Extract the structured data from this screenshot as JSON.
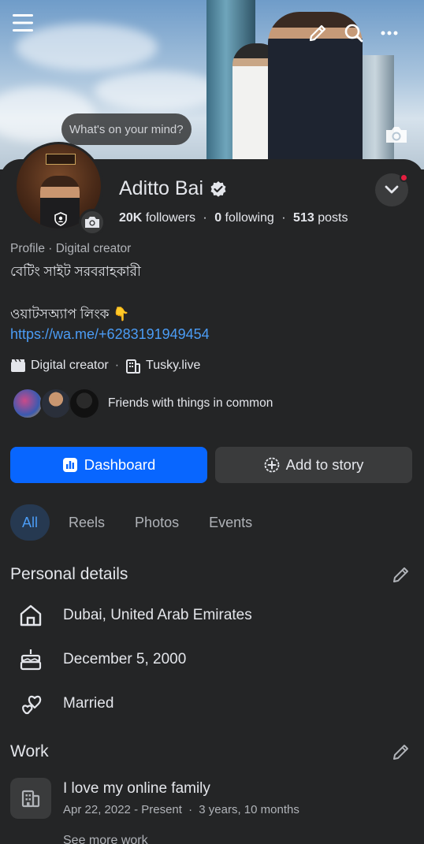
{
  "cover": {
    "status_bubble": "What's on your mind?"
  },
  "profile": {
    "name": "Aditto Bai",
    "followers_count": "20K",
    "followers_label": "followers",
    "following_count": "0",
    "following_label": "following",
    "posts_count": "513",
    "posts_label": "posts",
    "meta_line": "Profile · Digital creator",
    "bio_line1": "বেটিং সাইট সরবরাহকারী",
    "bio_line2": "ওয়াটসঅ্যাপ লিংক 👇",
    "link": "https://wa.me/+6283191949454",
    "tag_category": "Digital creator",
    "tag_separator": "·",
    "tag_site": "Tusky.live",
    "friends_label": "Friends with things in common"
  },
  "buttons": {
    "dashboard": "Dashboard",
    "add_story": "Add to story"
  },
  "tabs": [
    {
      "label": "All",
      "active": true
    },
    {
      "label": "Reels",
      "active": false
    },
    {
      "label": "Photos",
      "active": false
    },
    {
      "label": "Events",
      "active": false
    }
  ],
  "personal_details": {
    "title": "Personal details",
    "items": [
      {
        "icon": "home-icon",
        "text": "Dubai, United Arab Emirates"
      },
      {
        "icon": "birthday-cake-icon",
        "text": "December 5, 2000"
      },
      {
        "icon": "hearts-icon",
        "text": "Married"
      }
    ]
  },
  "work": {
    "title": "Work",
    "job_title": "I love my online family",
    "job_dates": "Apr 22, 2022 - Present",
    "job_duration_sep": "·",
    "job_duration": "3 years, 10 months",
    "see_more": "See more work"
  },
  "colors": {
    "background": "#242526",
    "primary_button": "#0866ff",
    "link": "#4b9cf5",
    "active_tab_bg": "#263951",
    "notification_dot": "#e41e3f"
  }
}
